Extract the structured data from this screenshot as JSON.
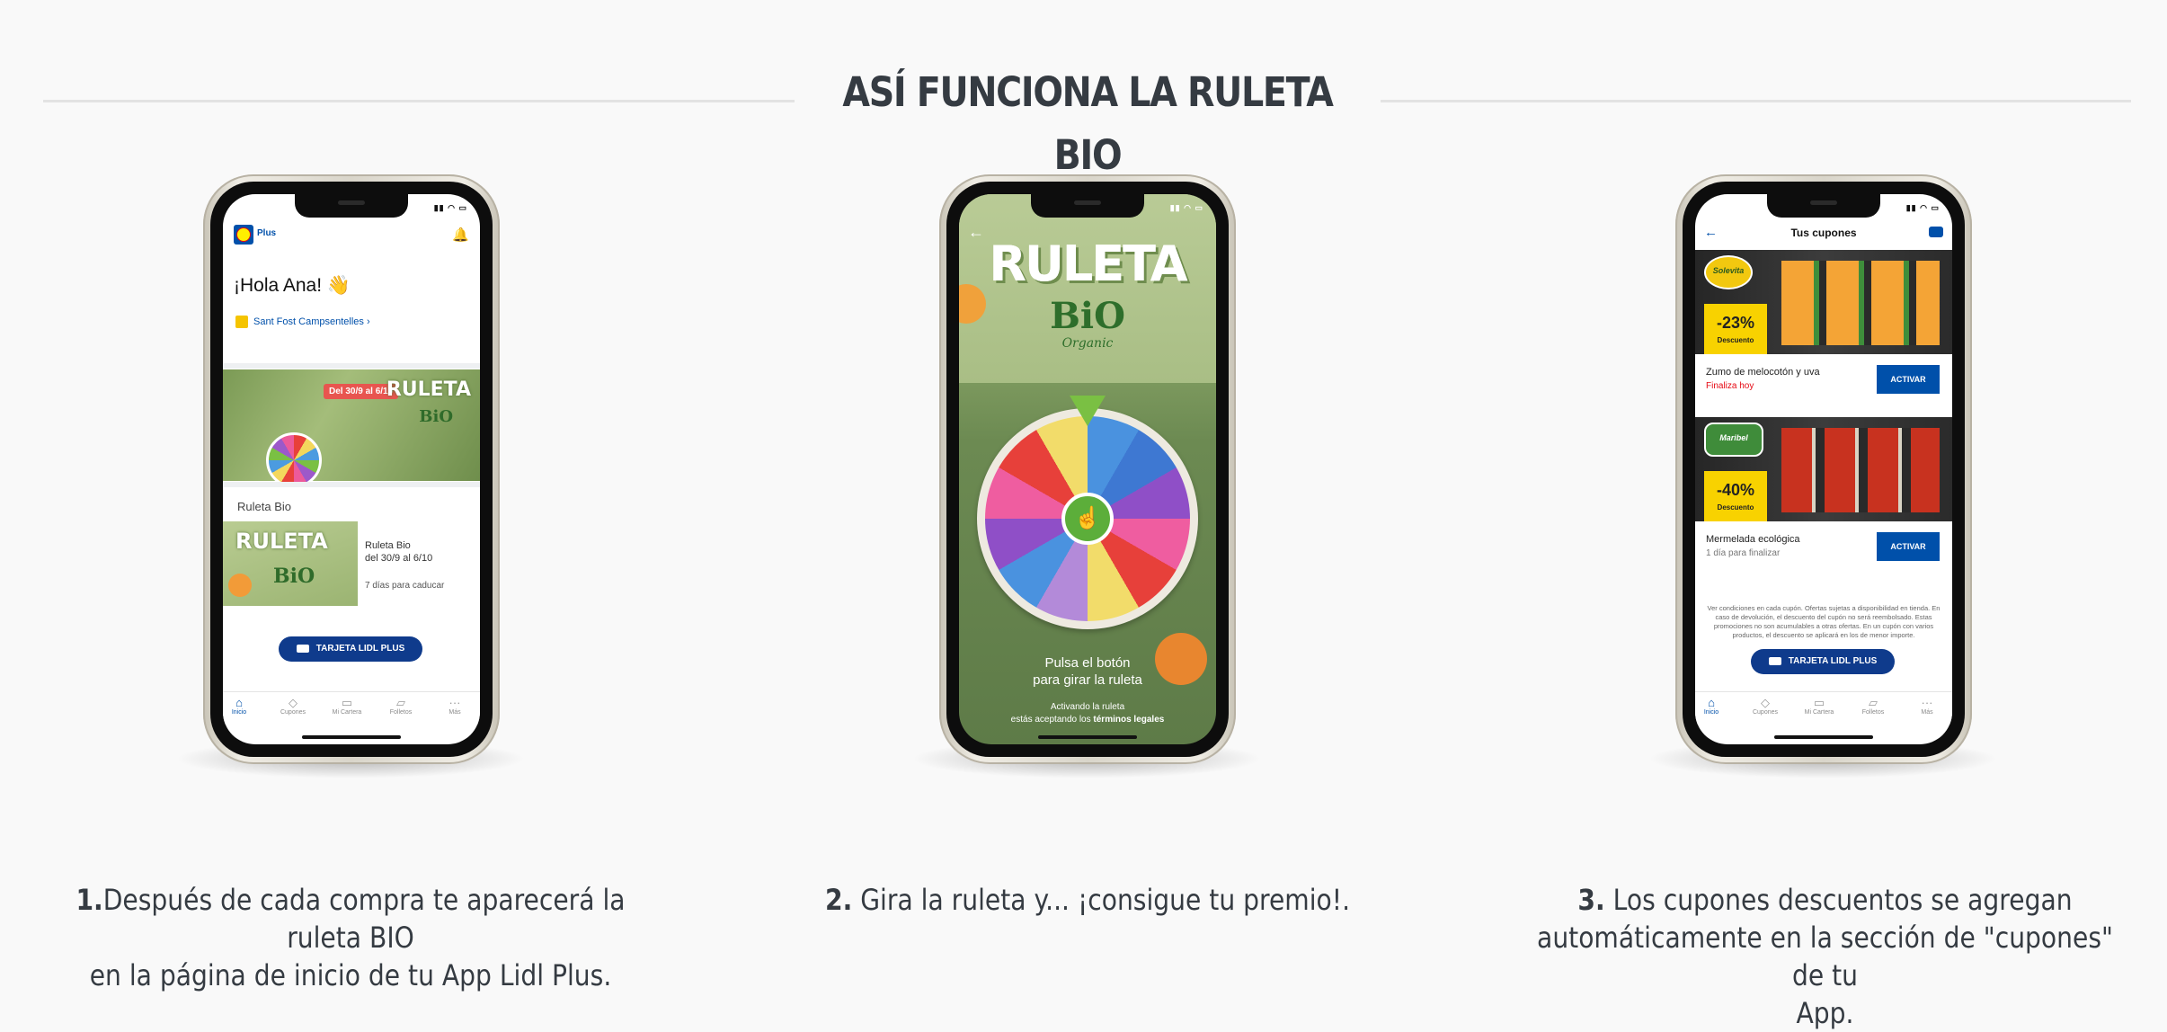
{
  "heading": "ASÍ FUNCIONA LA RULETA BIO",
  "steps": [
    {
      "num": "1.",
      "text_line1": "Después de cada compra te aparecerá la ruleta BIO",
      "text_line2": "en la página de inicio de tu App Lidl Plus."
    },
    {
      "num": "2.",
      "text": " Gira la ruleta y... ¡consigue tu premio!."
    },
    {
      "num": "3.",
      "text_line1": " Los cupones descuentos se agregan",
      "text_line2": "automáticamente en la sección de \"cupones\" de tu",
      "text_line3": "App."
    }
  ],
  "phone1": {
    "app_name": "Plus",
    "greeting": "¡Hola Ana! 👋",
    "store": "Sant Fost Campsentelles",
    "banner_dates": "Del 30/9 al 6/10",
    "banner_ruleta": "RULETA",
    "banner_bio": "BiO",
    "card_section": "Ruleta Bio",
    "card_img_ruleta": "RULETA",
    "card_img_bio": "BiO",
    "card_title": "Ruleta Bio",
    "card_dates": "del 30/9 al 6/10",
    "card_expiry": "7 días para caducar",
    "card_button": "TARJETA LIDL PLUS",
    "tabs": [
      "Inicio",
      "Cupones",
      "Mi Cartera",
      "Folletos",
      "Más"
    ]
  },
  "phone2": {
    "title": "RULETA",
    "bio": "BiO",
    "organic": "Organic",
    "instruction_line1": "Pulsa el botón",
    "instruction_line2": "para girar la ruleta",
    "terms_line1": "Activando la ruleta",
    "terms_line2_prefix": "estás aceptando los ",
    "terms_link": "términos legales"
  },
  "phone3": {
    "screen_title": "Tus cupones",
    "coupons": [
      {
        "brand": "Solevita",
        "discount": "-23%",
        "discount_label": "Descuento",
        "name": "Zumo de melocotón y uva",
        "expiry": "Finaliza hoy",
        "button": "ACTIVAR"
      },
      {
        "brand": "Maribel",
        "discount": "-40%",
        "discount_label": "Descuento",
        "name": "Mermelada ecológica",
        "expiry": "1 día para finalizar",
        "button": "ACTIVAR"
      }
    ],
    "legal": "Ver condiciones en cada cupón. Ofertas sujetas a disponibilidad en tienda. En caso de devolución, el descuento del cupón no será reembolsado. Estas promociones no son acumulables a otras ofertas. En un cupón con varios productos, el descuento se aplicará en los de menor importe.",
    "card_button": "TARJETA LIDL PLUS",
    "tabs": [
      "Inicio",
      "Cupones",
      "Mi Cartera",
      "Folletos",
      "Más"
    ]
  },
  "colors": {
    "lidl_blue": "#0050aa",
    "pill_navy": "#0f3b8c",
    "heading": "#353b42",
    "discount_yellow": "#f8d200",
    "expiry_red": "#e60a14"
  }
}
